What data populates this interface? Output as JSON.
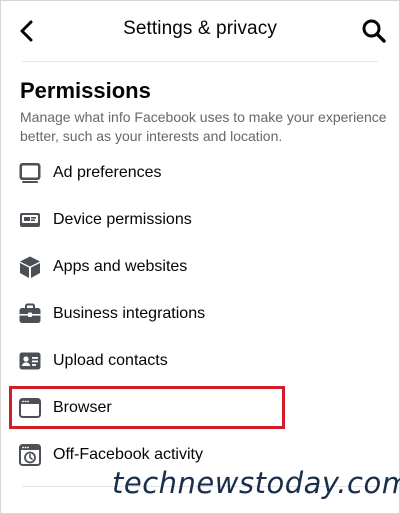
{
  "header": {
    "title": "Settings & privacy"
  },
  "section": {
    "title": "Permissions",
    "description": "Manage what info Facebook uses to make your experience better, such as your interests and location."
  },
  "items": [
    {
      "label": "Ad preferences",
      "icon": "ad-preferences-icon"
    },
    {
      "label": "Device permissions",
      "icon": "device-permissions-icon"
    },
    {
      "label": "Apps and websites",
      "icon": "apps-and-websites-icon"
    },
    {
      "label": "Business integrations",
      "icon": "briefcase-icon"
    },
    {
      "label": "Upload contacts",
      "icon": "contact-card-icon"
    },
    {
      "label": "Browser",
      "icon": "browser-window-icon",
      "highlighted": true
    },
    {
      "label": "Off-Facebook activity",
      "icon": "activity-history-icon"
    }
  ],
  "watermark": "technewstoday.com",
  "colors": {
    "highlight_border": "#d11f25",
    "primary_text": "#050505",
    "secondary_text": "#65676b"
  }
}
